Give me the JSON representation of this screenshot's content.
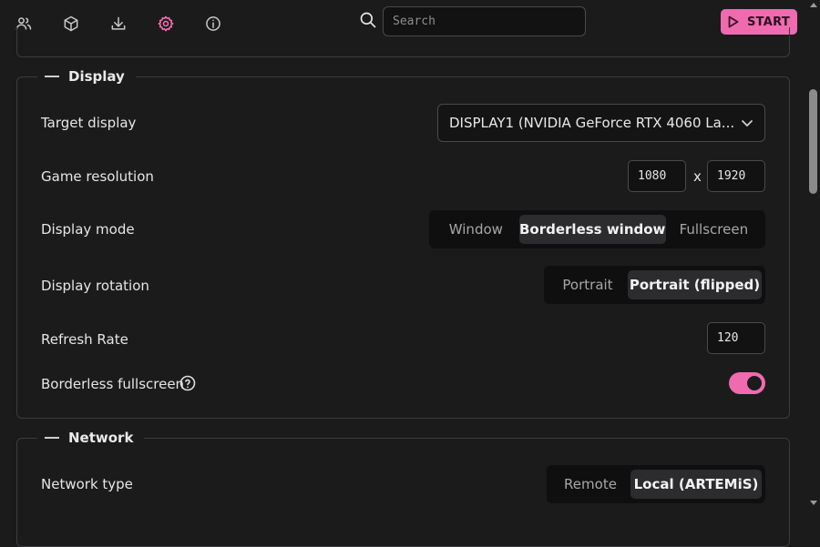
{
  "nav": {
    "items": [
      {
        "icon": "users-icon"
      },
      {
        "icon": "cube-icon"
      },
      {
        "icon": "download-icon"
      },
      {
        "icon": "gear-icon",
        "active": true
      },
      {
        "icon": "info-icon"
      }
    ]
  },
  "search": {
    "placeholder": "Search",
    "value": ""
  },
  "start_button": {
    "label": "START"
  },
  "display": {
    "title": "Display",
    "target_display": {
      "label": "Target display",
      "value": "DISPLAY1 (NVIDIA GeForce RTX 4060 La..."
    },
    "game_resolution": {
      "label": "Game resolution",
      "width": "1080",
      "separator": "x",
      "height": "1920"
    },
    "display_mode": {
      "label": "Display mode",
      "options": [
        "Window",
        "Borderless window",
        "Fullscreen"
      ],
      "selected": "Borderless window"
    },
    "display_rotation": {
      "label": "Display rotation",
      "options": [
        "Portrait",
        "Portrait (flipped)"
      ],
      "selected": "Portrait (flipped)"
    },
    "refresh_rate": {
      "label": "Refresh Rate",
      "value": "120"
    },
    "borderless_fullscreen": {
      "label": "Borderless fullscreen",
      "enabled": true
    }
  },
  "network": {
    "title": "Network",
    "network_type": {
      "label": "Network type",
      "options": [
        "Remote",
        "Local (ARTEMiS)"
      ],
      "selected": "Local (ARTEMiS)"
    }
  },
  "colors": {
    "accent": "#f06ab0",
    "background": "#1b1b1c"
  }
}
